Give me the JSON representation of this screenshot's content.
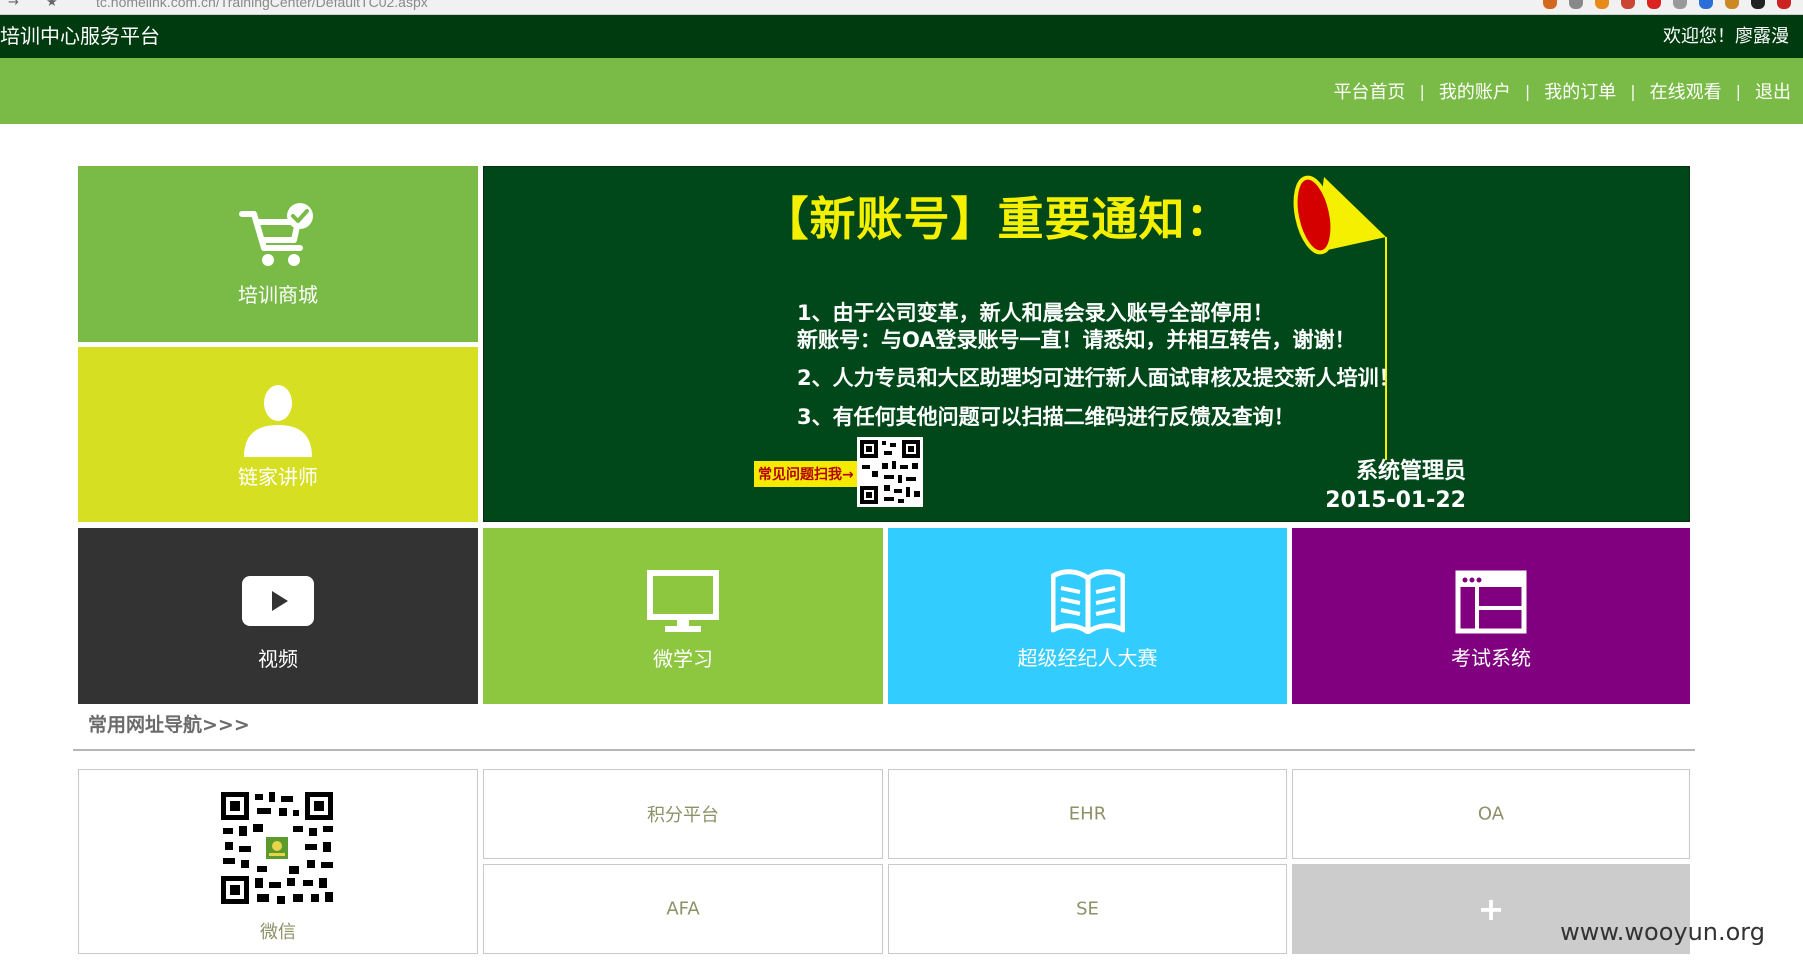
{
  "browser": {
    "url": "tc.homelink.com.cn/TrainingCenter/DefaultTC02.aspx"
  },
  "header": {
    "title": "培训中心服务平台",
    "welcome": "欢迎您！廖露漫"
  },
  "nav": {
    "links": [
      "平台首页",
      "我的账户",
      "我的订单",
      "在线观看",
      "退出"
    ],
    "separator": "|"
  },
  "tiles": {
    "shop": {
      "label": "培训商城",
      "color": "#79bb46"
    },
    "lecturer": {
      "label": "链家讲师",
      "color": "#d7df23"
    },
    "video": {
      "label": "视频",
      "color": "#333333"
    },
    "micro": {
      "label": "微学习",
      "color": "#8dc63f"
    },
    "contest": {
      "label": "超级经纪人大赛",
      "color": "#33ccff"
    },
    "exam": {
      "label": "考试系统",
      "color": "#800080"
    }
  },
  "notice": {
    "heading": "【新账号】重要通知：",
    "line1": "1、由于公司变革，新人和晨会录入账号全部停用！",
    "line1b": "新账号：与OA登录账号一直！请悉知，并相互转告，谢谢！",
    "line2": "2、人力专员和大区助理均可进行新人面试审核及提交新人培训！",
    "line3": "3、有任何其他问题可以扫描二维码进行反馈及查询！",
    "scan_label": "常见问题扫我→",
    "signature": "系统管理员",
    "date": "2015-01-22"
  },
  "links_section": {
    "heading": "常用网址导航>>>",
    "wechat": "微信",
    "items": [
      "积分平台",
      "EHR",
      "OA",
      "AFA",
      "SE"
    ],
    "add": "+"
  },
  "watermark": "www.wooyun.org"
}
